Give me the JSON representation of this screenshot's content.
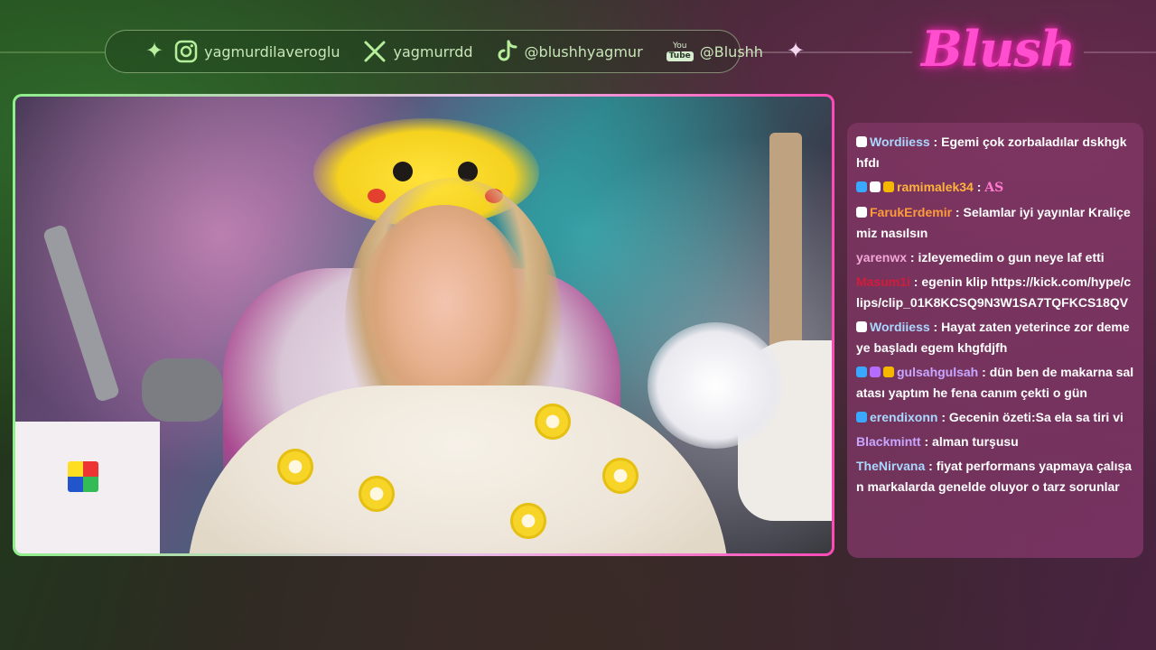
{
  "socials": [
    {
      "platform_icon": "instagram-icon",
      "handle": "yagmurdilaveroglu"
    },
    {
      "platform_icon": "x-icon",
      "handle": "yagmurrdd"
    },
    {
      "platform_icon": "tiktok-icon",
      "handle": "@blushhyagmur"
    },
    {
      "platform_icon": "youtube-icon",
      "handle": "@Blushh",
      "badge_top": "You",
      "badge_bottom": "Tube"
    }
  ],
  "logo": {
    "text": "Blush"
  },
  "colors": {
    "accent_green": "#8ef08a",
    "accent_pink": "#ff49b6",
    "chat_bg": "#8c3c6e"
  },
  "chat": {
    "messages": [
      {
        "user": "Wordiiess",
        "user_color": "#a9d8ff",
        "badges": [
          "#ffffff"
        ],
        "text": "Egemi çok zorbaladılar dskhgkhfdı"
      },
      {
        "user": "ramimalek34",
        "user_color": "#ffb23b",
        "badges": [
          "#3aa8ff",
          "#ffffff",
          "#f5b800"
        ],
        "text": "",
        "emote": "AS"
      },
      {
        "user": "FarukErdemir",
        "user_color": "#ff9a3b",
        "badges": [
          "#ffffff"
        ],
        "text": "Selamlar iyi yayınlar Kraliçemiz nasılsın"
      },
      {
        "user": "yarenwx",
        "user_color": "#f3a6d8",
        "badges": [],
        "text": "izleyemedim o gun neye laf etti"
      },
      {
        "user": "Masum1i",
        "user_color": "#d21c3c",
        "badges": [],
        "text": "egenin klip https://kick.com/hype/clips/clip_01K8KCSQ9N3W1SA7TQFKCS18QV"
      },
      {
        "user": "Wordiiess",
        "user_color": "#a9d8ff",
        "badges": [
          "#ffffff"
        ],
        "text": "Hayat zaten yeterince zor demeye başladı egem khgfdjfh"
      },
      {
        "user": "gulsahgulsah",
        "user_color": "#c7a6ff",
        "badges": [
          "#3aa8ff",
          "#b46bff",
          "#f5b800"
        ],
        "text": "dün ben de makarna salatası yaptım he fena canım çekti o gün"
      },
      {
        "user": "erendixonn",
        "user_color": "#a9d8ff",
        "badges": [
          "#3aa8ff"
        ],
        "text": "Gecenin özeti:Sa ela sa tiri vi"
      },
      {
        "user": "Blackmintt",
        "user_color": "#c7a6ff",
        "badges": [],
        "text": "alman turşusu"
      },
      {
        "user": "TheNirvana",
        "user_color": "#a9d8ff",
        "badges": [],
        "text": "fiyat performans yapmaya çalışan markalarda genelde oluyor o tarz sorunlar"
      }
    ]
  }
}
